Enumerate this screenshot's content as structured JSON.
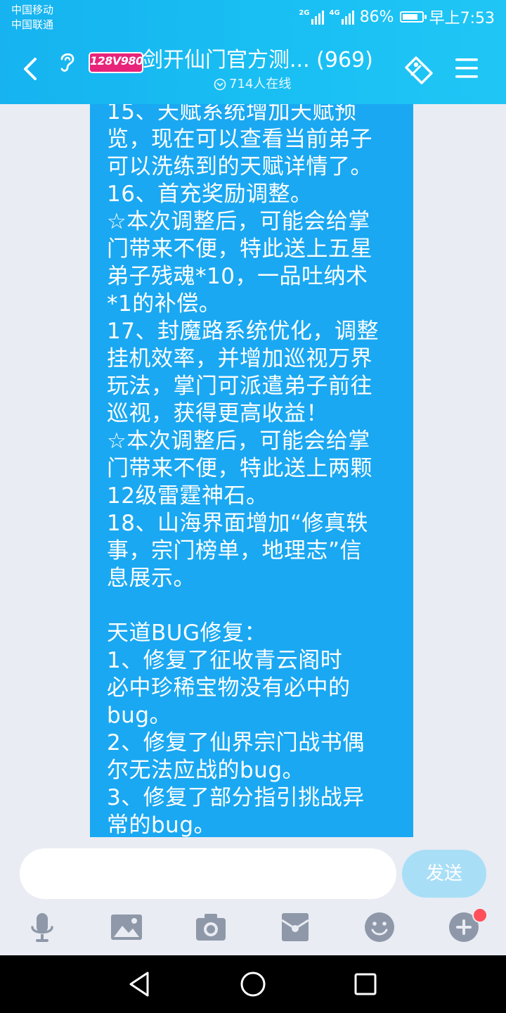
{
  "status_bar": {
    "carrier_1": "中国移动",
    "carrier_2": "中国联通",
    "signal_1_type": "2G",
    "signal_2_type": "4G",
    "battery_percent": "86%",
    "battery_level": 0.86,
    "time": "早上7:53"
  },
  "header": {
    "logo_text": "128V980",
    "title": "剑开仙门官方测...",
    "member_count": "(969)",
    "online": "714人在线",
    "icons": {
      "back": "chevron-left-icon",
      "ear": "ear-icon",
      "online": "chevron-down-circle-icon",
      "tag": "tag-icon",
      "menu": "menu-icon"
    }
  },
  "message": {
    "lines": [
      "15、天赋系统增加天赋预",
      "览，现在可以查看当前弟子",
      "可以洗练到的天赋详情了。",
      "16、首充奖励调整。",
      "☆本次调整后，可能会给掌",
      "门带来不便，特此送上五星",
      "弟子残魂*10，一品吐纳术",
      "*1的补偿。",
      "17、封魔路系统优化，调整",
      "挂机效率，并增加巡视万界",
      "玩法，掌门可派遣弟子前往",
      "巡视，获得更高收益！",
      "☆本次调整后，可能会给掌",
      "门带来不便，特此送上两颗",
      "12级雷霆神石。",
      "18、山海界面增加“修真轶",
      "事，宗门榜单，地理志”信",
      "息展示。",
      "",
      "天道BUG修复：",
      "1、修复了征收青云阁时",
      "必中珍稀宝物没有必中的",
      "bug。",
      "2、修复了仙界宗门战书偶",
      "尔无法应战的bug。",
      "3、修复了部分指引挑战异",
      "常的bug。"
    ]
  },
  "input": {
    "value": "",
    "placeholder": "",
    "send_label": "发送"
  },
  "toolbar": {
    "icons": [
      "microphone-icon",
      "image-icon",
      "camera-icon",
      "red-packet-icon",
      "emoji-icon",
      "plus-icon"
    ],
    "plus_has_badge": true
  },
  "navbar": {
    "icons": [
      "back-triangle-icon",
      "home-circle-icon",
      "recents-square-icon"
    ]
  },
  "colors": {
    "header_blue": "#19bff3",
    "bubble_blue": "#1aa8f2",
    "background": "#e9ecf3",
    "send_disabled": "#a9def7",
    "icon_gray": "#8e98a8",
    "badge_red": "#ff4f59"
  }
}
